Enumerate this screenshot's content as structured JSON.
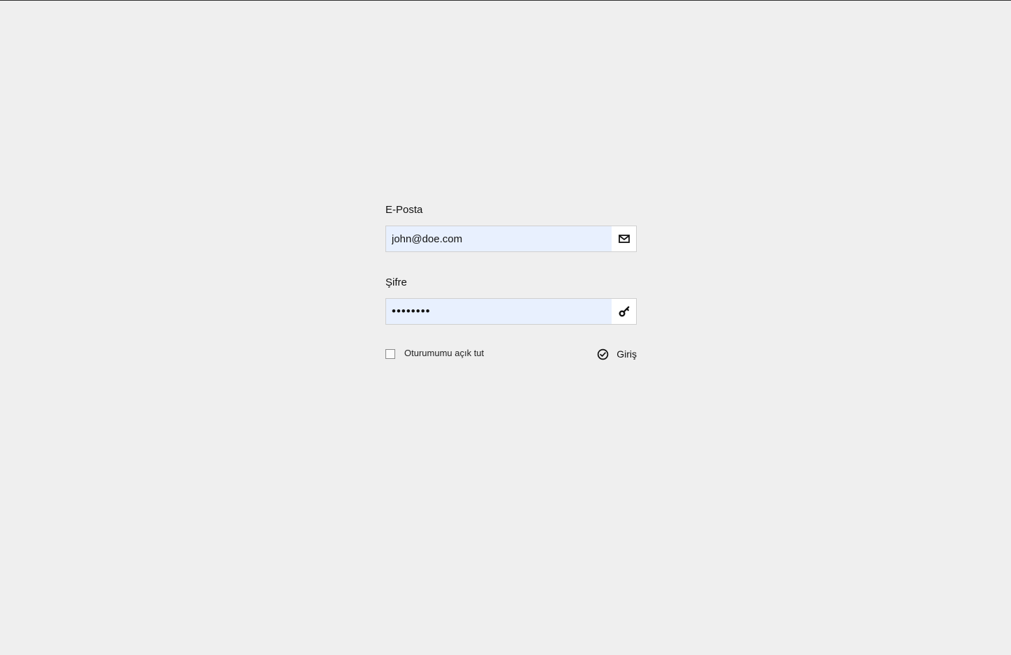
{
  "form": {
    "email": {
      "label": "E-Posta",
      "value": "john@doe.com",
      "icon": "envelope-icon"
    },
    "password": {
      "label": "Şifre",
      "value": "••••••••",
      "icon": "key-icon"
    },
    "remember": {
      "label": "Oturumumu açık tut",
      "checked": false
    },
    "submit": {
      "label": "Giriş",
      "icon": "check-circle-icon"
    }
  },
  "colors": {
    "background": "#efefef",
    "input_autofill": "#e8f0fe",
    "border": "#cfcfcf",
    "text": "#111111"
  }
}
